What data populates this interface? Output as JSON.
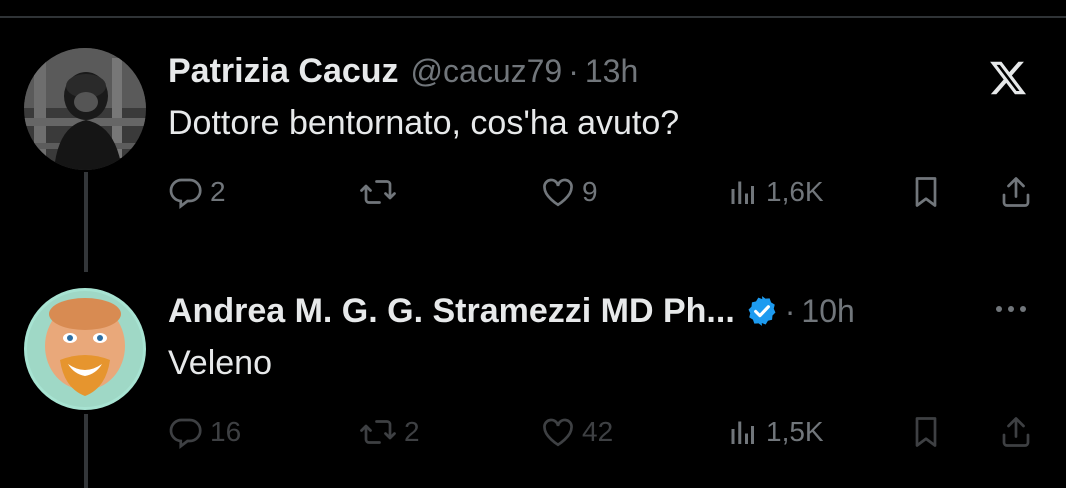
{
  "tweets": [
    {
      "name": "Patrizia Cacuz",
      "handle": "@cacuz79",
      "separator": "·",
      "time": "13h",
      "text": "Dottore bentornato, cos'ha avuto?",
      "verified": false,
      "replies": "2",
      "retweets": "",
      "likes": "9",
      "views": "1,6K"
    },
    {
      "name": "Andrea M. G. G. Stramezzi MD Ph...",
      "handle": "",
      "separator": "·",
      "time": "10h",
      "text": "Veleno",
      "verified": true,
      "replies": "16",
      "retweets": "2",
      "likes": "42",
      "views": "1,5K"
    }
  ],
  "icons": {
    "platform": "x-logo-icon",
    "verified": "verified-badge-icon",
    "reply": "reply-icon",
    "retweet": "retweet-icon",
    "like": "heart-icon",
    "views": "views-icon",
    "bookmark": "bookmark-icon",
    "share": "share-icon",
    "more": "more-icon"
  },
  "colors": {
    "background": "#000000",
    "text": "#e7e9ea",
    "secondary": "#71767b",
    "verified": "#1d9bf0"
  }
}
